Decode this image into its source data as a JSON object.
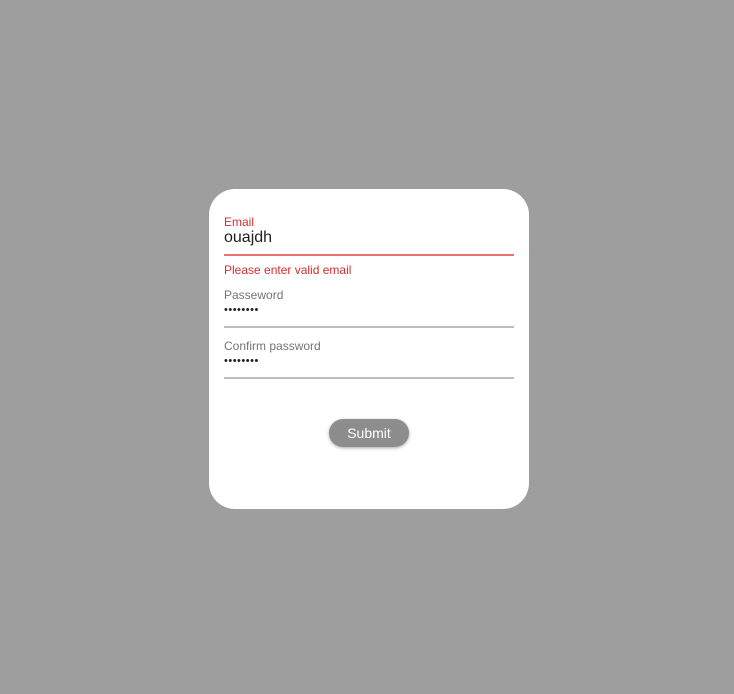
{
  "form": {
    "email": {
      "label": "Email",
      "value": "ouajdh",
      "error": "Please enter valid email"
    },
    "password": {
      "label": "Passeword",
      "value": "••••••••"
    },
    "confirm_password": {
      "label": "Confirm password",
      "value": "••••••••"
    },
    "submit_label": "Submit"
  },
  "colors": {
    "page_background": "#9e9e9e",
    "card_background": "#ffffff",
    "error": "#d32f2f",
    "error_underline": "#e57373",
    "button_background": "#8d8d8d"
  }
}
